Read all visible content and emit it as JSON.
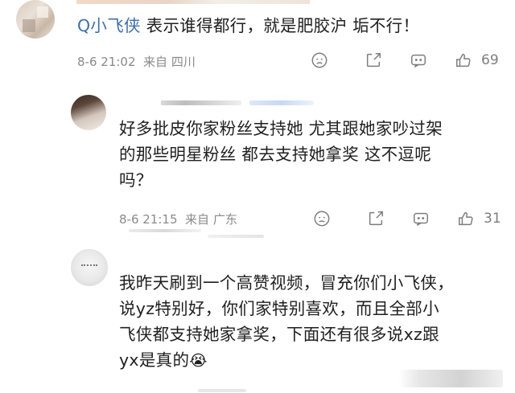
{
  "comments": [
    {
      "mention": "Q小飞侠",
      "text": " 表示谁得都行，就是肥胶沪  垢不行！",
      "date": "8-6 21:02",
      "location": "来自 四川",
      "likes": "69"
    },
    {
      "text_lines": [
        "好多批皮你家粉丝支持她 尤其跟她家吵过架",
        "的那些明星粉丝 都去支持她拿奖 这不逗呢",
        "吗？"
      ],
      "date": "8-6 21:15",
      "location": "来自 广东",
      "likes": "31"
    },
    {
      "text_lines": [
        "我昨天刷到一个高赞视频，冒充你们小飞侠，",
        "说yz特别好，你们家特别喜欢，而且全部小",
        "飞侠都支持她家拿奖，下面还有很多说xz跟",
        "yx是真的"
      ],
      "emoji": "😭"
    }
  ],
  "icons": [
    "dislike-icon",
    "share-icon",
    "comment-icon",
    "like-icon"
  ]
}
